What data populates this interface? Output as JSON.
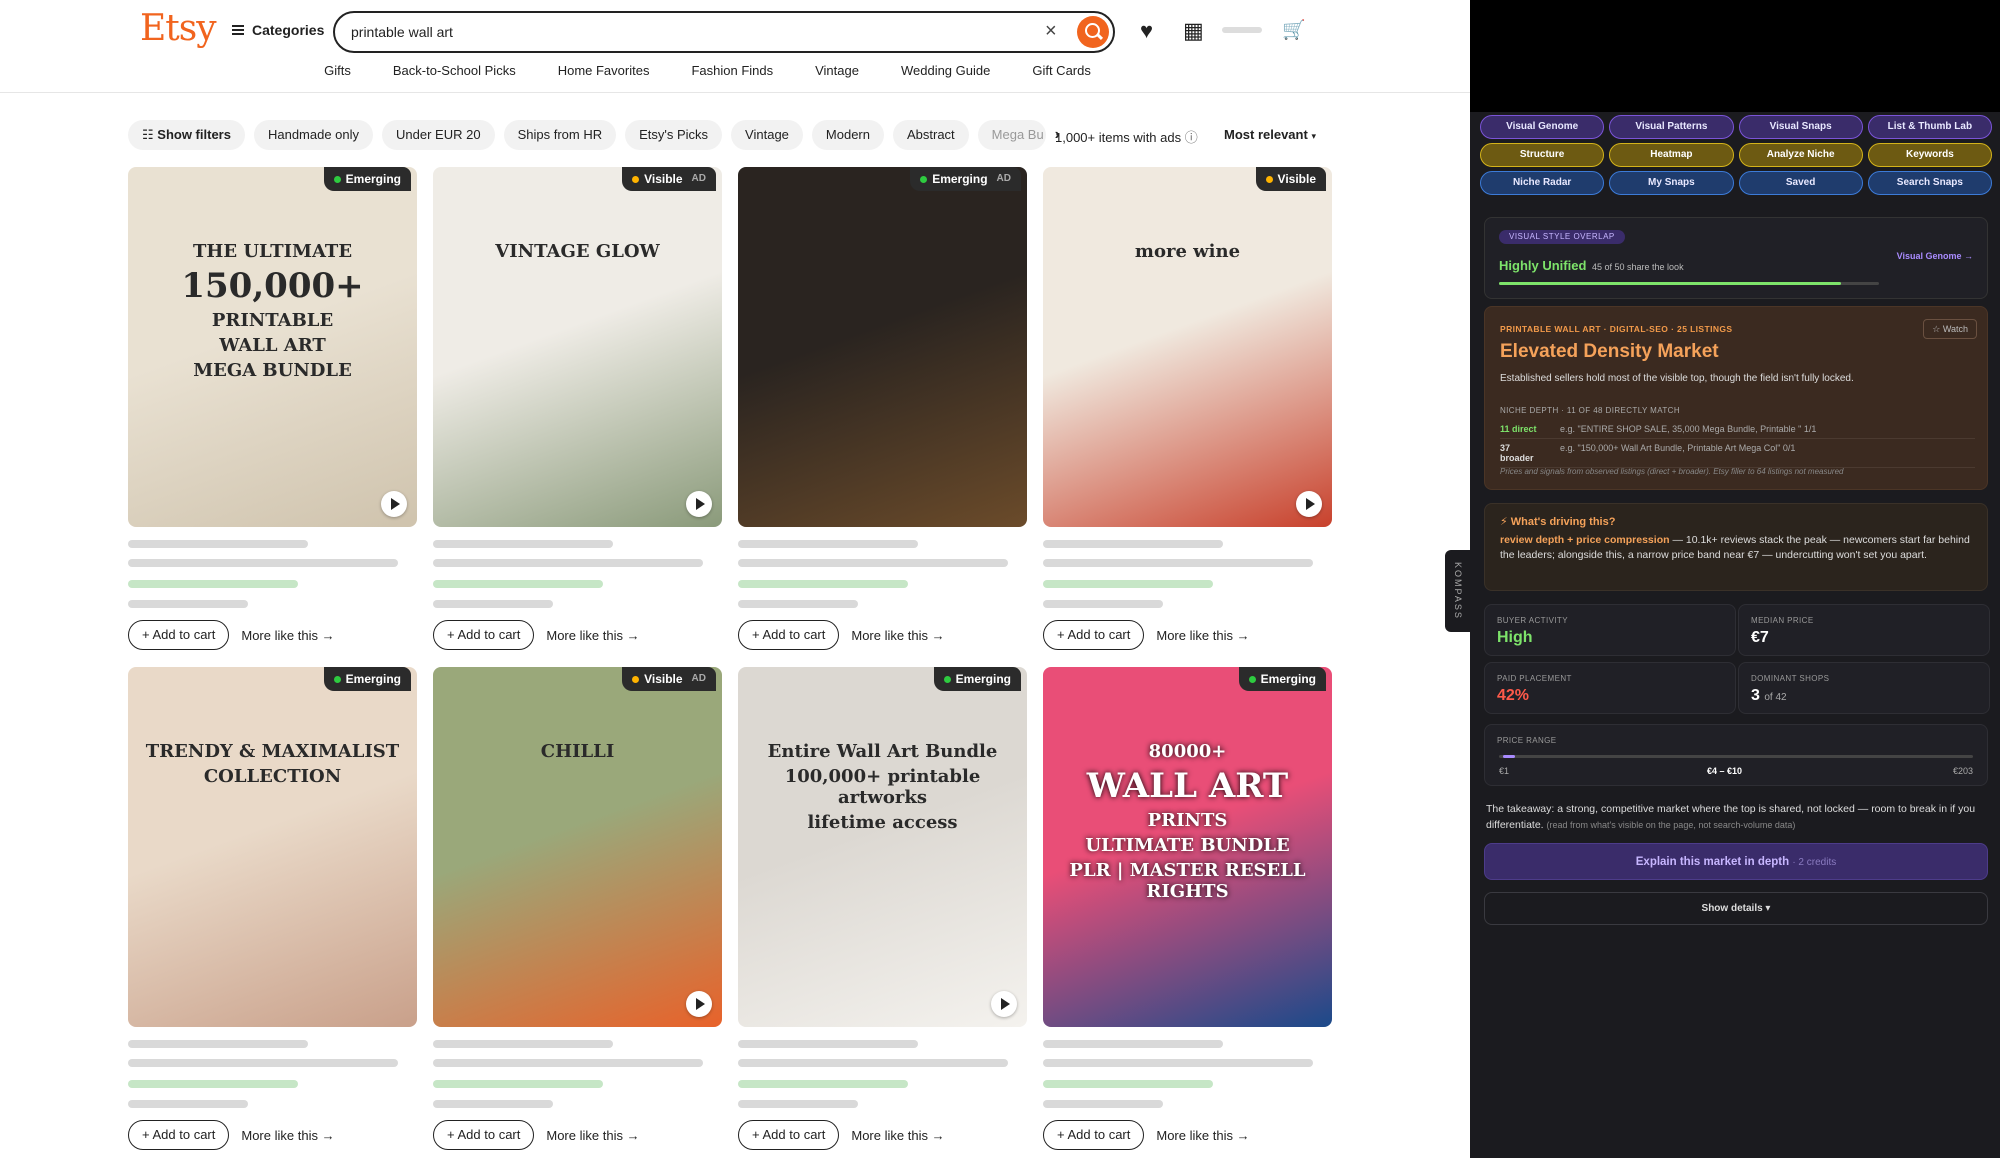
{
  "header": {
    "logo": "Etsy",
    "categories": "Categories",
    "search_value": "printable wall art",
    "clear_glyph": "×",
    "heart_glyph": "♥",
    "registry_glyph": "▦",
    "cart_glyph": "🛒"
  },
  "nav": [
    "Gifts",
    "Back-to-School Picks",
    "Home Favorites",
    "Fashion Finds",
    "Vintage",
    "Wedding Guide",
    "Gift Cards"
  ],
  "filters": {
    "show_filters": "Show filters",
    "chips": [
      "Handmade only",
      "Under EUR 20",
      "Ships from HR",
      "Etsy's Picks",
      "Vintage",
      "Modern",
      "Abstract",
      "Mega Bu"
    ],
    "items_count": "1,000+ items",
    "with_ads": "with ads",
    "sort": "Most relevant"
  },
  "listings": [
    {
      "badge": "Emerging",
      "ad": false,
      "play": true,
      "overlay": [
        "THE ULTIMATE",
        "150,000+",
        "PRINTABLE",
        "WALL ART",
        "MEGA BUNDLE"
      ],
      "colors": [
        "#e9e1d2",
        "#cfc3ad"
      ]
    },
    {
      "badge": "Visible",
      "ad": true,
      "play": true,
      "overlay": [
        "VINTAGE GLOW"
      ],
      "colors": [
        "#efece6",
        "#8a9a7a"
      ]
    },
    {
      "badge": "Emerging",
      "ad": true,
      "play": false,
      "overlay": [],
      "colors": [
        "#2a2420",
        "#6b4b2a"
      ]
    },
    {
      "badge": "Visible",
      "ad": false,
      "play": true,
      "overlay": [
        "more wine"
      ],
      "colors": [
        "#f0e9df",
        "#c8412c"
      ]
    },
    {
      "badge": "Emerging",
      "ad": false,
      "play": false,
      "overlay": [
        "TRENDY & MAXIMALIST",
        "COLLECTION"
      ],
      "colors": [
        "#e9d9c8",
        "#c9a08a"
      ]
    },
    {
      "badge": "Visible",
      "ad": true,
      "play": true,
      "overlay": [
        "CHILLI"
      ],
      "colors": [
        "#9aa87a",
        "#e8622a"
      ]
    },
    {
      "badge": "Emerging",
      "ad": false,
      "play": true,
      "overlay": [
        "Entire Wall Art Bundle",
        "100,000+ printable artworks",
        "lifetime access"
      ],
      "colors": [
        "#dcd8d2",
        "#f4f2ee"
      ]
    },
    {
      "badge": "Emerging",
      "ad": false,
      "play": false,
      "overlay": [
        "80000+",
        "WALL ART",
        "PRINTS",
        "ULTIMATE BUNDLE",
        "PLR | MASTER RESELL RIGHTS"
      ],
      "colors": [
        "#e94e77",
        "#1b4a8a"
      ]
    }
  ],
  "card_actions": {
    "add_to_cart": "Add to cart",
    "more_like_this": "More like this"
  },
  "kompass": "KOMPASS",
  "sidebar": {
    "tabs": [
      {
        "label": "Visual Genome",
        "style": "p"
      },
      {
        "label": "Visual Patterns",
        "style": "p"
      },
      {
        "label": "Visual Snaps",
        "style": "p"
      },
      {
        "label": "List & Thumb Lab",
        "style": "p"
      },
      {
        "label": "Structure",
        "style": "o"
      },
      {
        "label": "Heatmap",
        "style": "o"
      },
      {
        "label": "Analyze Niche",
        "style": "o"
      },
      {
        "label": "Keywords",
        "style": "o"
      },
      {
        "label": "Niche Radar",
        "style": "b"
      },
      {
        "label": "My Snaps",
        "style": "b"
      },
      {
        "label": "Saved",
        "style": "b"
      },
      {
        "label": "Search Snaps",
        "style": "b"
      }
    ],
    "overlay": {
      "pill": "VISUAL STYLE OVERLAP",
      "status": "Highly Unified",
      "share": "45 of 50 share the look",
      "link": "Visual Genome →",
      "fraction": 0.9
    },
    "density": {
      "kicker": "PRINTABLE WALL ART · DIGITAL-SEO · 25 LISTINGS",
      "title": "Elevated Density Market",
      "watch": "☆ Watch",
      "desc": "Established sellers hold most of the visible top, though the field isn't fully locked.",
      "niche_depth": "NICHE DEPTH · 11 OF 48 DIRECTLY MATCH",
      "direct_label": "11 direct",
      "direct_eg": "e.g. \"ENTIRE SHOP SALE, 35,000 Mega Bundle, Printable \" 1/1",
      "broader_label": "37 broader",
      "broader_eg": "e.g. \"150,000+ Wall Art Bundle, Printable Art Mega Col\" 0/1",
      "note": "Prices and signals from observed listings (direct + broader). Etsy filler to 64 listings not measured"
    },
    "driving": {
      "title": "⚡ What's driving this?",
      "highlight": "review depth + price compression",
      "body": " — 10.1k+ reviews stack the peak — newcomers start far behind the leaders; alongside this, a narrow price band near €7 — undercutting won't set you apart."
    },
    "stats": {
      "buyer_label": "BUYER ACTIVITY",
      "buyer_value": "High",
      "median_label": "MEDIAN PRICE",
      "median_value": "€7",
      "paid_label": "PAID PLACEMENT",
      "paid_value": "42%",
      "shops_label": "DOMINANT SHOPS",
      "shops_value": "3",
      "shops_of": "of 42"
    },
    "price": {
      "label": "PRICE RANGE",
      "min": "€1",
      "band": "€4 – €10",
      "max": "€203"
    },
    "takeaway": "The takeaway: a strong, competitive market where the top is shared, not locked — room to break in if you differentiate.",
    "takeaway_note": "(read from what's visible on the page, not search-volume data)",
    "explain": "Explain this market in depth",
    "explain_credits": "· 2 credits",
    "show_details": "Show details ▾"
  },
  "colors": {
    "brand": "#f1641e",
    "green": "#7de36a",
    "orange": "#f5a25a",
    "purple": "#a98bff",
    "red": "#ff5a4a"
  }
}
